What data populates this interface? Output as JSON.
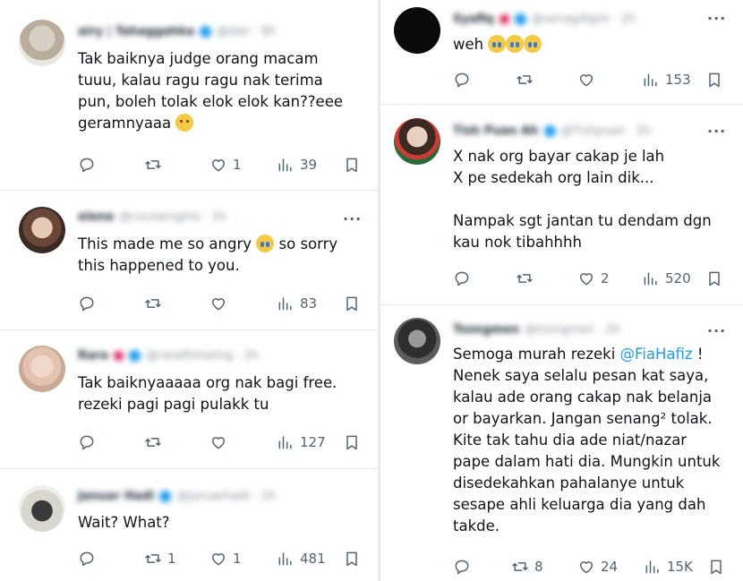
{
  "left_column": [
    {
      "author": {
        "name": "airy | Tahaggahka",
        "handle": "@dah · 8h",
        "verified": true
      },
      "text": "Tak baiknya judge orang macam tuuu, kalau ragu ragu nak terima pun, boleh tolak elok elok kan??eee geramnyaaa",
      "emoji": "pleading-face",
      "replies": "",
      "retweets": "",
      "likes": "1",
      "views": "39"
    },
    {
      "author": {
        "name": "elena",
        "handle": "@cocoanights · 2h",
        "verified": false
      },
      "text": "This made me so angry",
      "text2": " so sorry this happened to you.",
      "emoji": "crying-face",
      "replies": "",
      "retweets": "",
      "likes": "",
      "views": "83"
    },
    {
      "author": {
        "name": "Rara",
        "handle": "@rarafthhaiing · 2h",
        "verified": true
      },
      "text": "Tak baiknyaaaaa org nak bagi free.\nrezeki pagi pagi pulakk tu",
      "replies": "",
      "retweets": "",
      "likes": "",
      "views": "127"
    },
    {
      "author": {
        "name": "Januar Hadi",
        "handle": "@januarhadi · 2h",
        "verified": true
      },
      "text": "Wait? What?",
      "replies": "",
      "retweets": "1",
      "likes": "1",
      "views": "481"
    }
  ],
  "right_column": [
    {
      "author": {
        "name": "Syafiq",
        "handle": "@senagdigiin · 2h",
        "verified": true
      },
      "text": "weh",
      "emoji": "crying-face ×3",
      "replies": "",
      "retweets": "",
      "likes": "",
      "views": "153"
    },
    {
      "author": {
        "name": "Tish Puan Ah",
        "handle": "@Tishpuan · 2h",
        "verified": true
      },
      "text": "X nak org bayar cakap je lah\nX pe sedekah org lain dik...\n\nNampak sgt jantan tu dendam dgn kau nok tibahhhh",
      "replies": "",
      "retweets": "",
      "likes": "2",
      "views": "520"
    },
    {
      "author": {
        "name": "Tsongmen",
        "handle": "@tsongmen · 2h",
        "verified": false
      },
      "text_before": "Semoga murah rezeki ",
      "mention": "@FiaHafiz",
      "text_after": " !\nNenek saya selalu pesan kat saya, kalau ade orang cakap nak belanja or bayarkan. Jangan senang² tolak. Kite tak tahu dia ade niat/nazar pape dalam hati dia. Mungkin untuk disedekahkan pahalanye untuk sesape ahli keluarga dia yang dah takde.",
      "replies": "",
      "retweets": "8",
      "likes": "24",
      "views": "15K"
    }
  ],
  "icons": [
    "reply-icon",
    "retweet-icon",
    "like-icon",
    "views-icon",
    "bookmark-icon",
    "more-icon",
    "verified-icon"
  ],
  "colors": {
    "accent": "#1d9bf0",
    "muted": "#536471",
    "text": "#0f1419",
    "divider": "#e6e9ec"
  }
}
